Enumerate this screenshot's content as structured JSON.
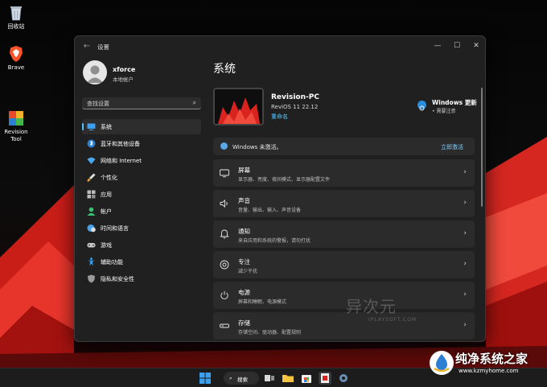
{
  "desktop": {
    "icons": [
      {
        "label": "回收站"
      },
      {
        "label": "Brave"
      },
      {
        "label": "Revision\nTool"
      }
    ]
  },
  "window": {
    "title": "设置",
    "back_glyph": "←",
    "minimize_glyph": "—",
    "maximize_glyph": "☐",
    "close_glyph": "✕"
  },
  "profile": {
    "name": "xforce",
    "account_type": "本地帐户"
  },
  "search": {
    "placeholder": "查找设置",
    "icon_glyph": "⌕"
  },
  "sidebar": {
    "items": [
      {
        "label": "系统",
        "icon": "monitor-icon",
        "active": true
      },
      {
        "label": "蓝牙和其他设备",
        "icon": "bluetooth-icon"
      },
      {
        "label": "网络和 Internet",
        "icon": "wifi-icon"
      },
      {
        "label": "个性化",
        "icon": "brush-icon"
      },
      {
        "label": "应用",
        "icon": "apps-icon"
      },
      {
        "label": "帐户",
        "icon": "person-icon"
      },
      {
        "label": "时间和语言",
        "icon": "globe-clock-icon"
      },
      {
        "label": "游戏",
        "icon": "gamepad-icon"
      },
      {
        "label": "辅助功能",
        "icon": "accessibility-icon"
      },
      {
        "label": "隐私和安全性",
        "icon": "shield-icon"
      }
    ]
  },
  "main": {
    "title": "系统",
    "device": {
      "name": "Revision-PC",
      "os": "ReviOS 11 22.12",
      "rename_link": "重命名"
    },
    "windows_update": {
      "title": "Windows 更新",
      "status": "• 需要注意"
    },
    "activation": {
      "text": "Windows 未激活。",
      "action": "立即激活"
    },
    "rows": [
      {
        "title": "屏幕",
        "subtitle": "显示器、亮度、夜间模式、显示器配置文件",
        "icon": "display-icon"
      },
      {
        "title": "声音",
        "subtitle": "音量、输出、输入、声音设备",
        "icon": "speaker-icon"
      },
      {
        "title": "通知",
        "subtitle": "来自应用和系统的警报，请勿打扰",
        "icon": "bell-icon"
      },
      {
        "title": "专注",
        "subtitle": "减少干扰",
        "icon": "focus-icon"
      },
      {
        "title": "电源",
        "subtitle": "屏幕和睡眠、电源模式",
        "icon": "power-icon"
      },
      {
        "title": "存储",
        "subtitle": "存储空间、驱动器、配置规则",
        "icon": "storage-icon"
      }
    ],
    "chevron": "›"
  },
  "watermarks": {
    "iplaysoft_cn": "异次元",
    "iplaysoft_en": "IPLAYSOFT.COM",
    "site_cn": "纯净系统之家",
    "site_url": "www.kzmyhome.com"
  },
  "taskbar": {
    "search_label": "搜索",
    "search_glyph": "⌕"
  },
  "colors": {
    "accent": "#4cc2ff",
    "window_bg": "#202020",
    "card_bg": "#2b2b2b",
    "wallpaper_red": "#d8231e"
  }
}
